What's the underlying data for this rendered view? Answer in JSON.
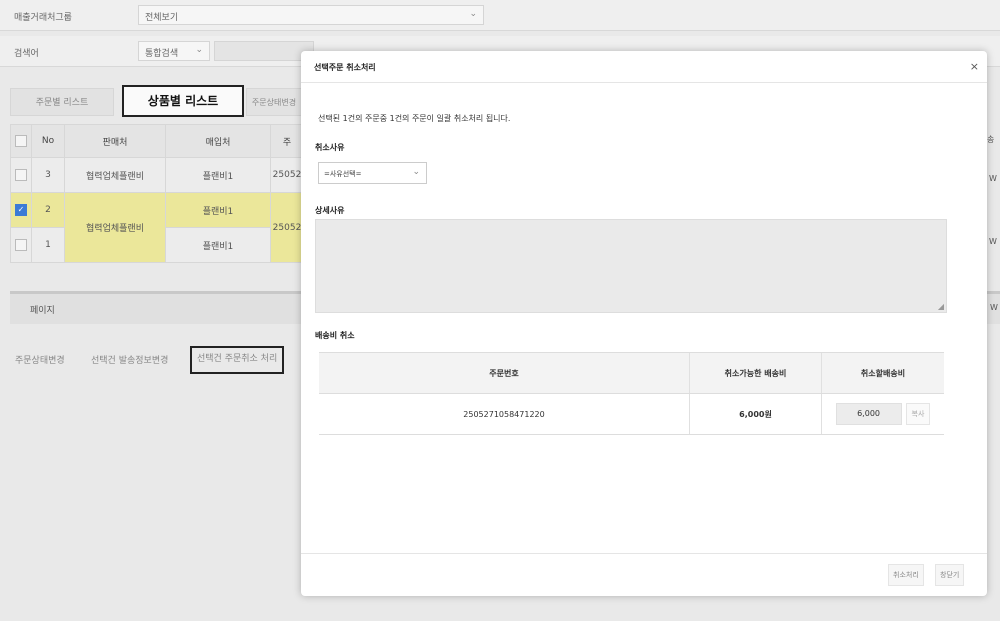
{
  "filters": {
    "partner_group": {
      "label": "매출거래처그룹",
      "value": "전체보기"
    },
    "search": {
      "label": "검색어",
      "type": "통합검색"
    }
  },
  "tabs": [
    "주문별 리스트",
    "상품별 리스트",
    "주문상태변경"
  ],
  "grid": {
    "headers": [
      "No",
      "판매처",
      "매입처",
      "주"
    ],
    "rows": [
      {
        "no": "3",
        "seller": "협력업체플랜비",
        "buyer": "플랜비1",
        "order": "25052",
        "extra": "W",
        "checked": false
      },
      {
        "no": "2",
        "seller": "협력업체플랜비",
        "buyer": "플랜비1",
        "order": "25052",
        "extra": "W",
        "checked": true
      },
      {
        "no": "1",
        "seller": "",
        "buyer": "플랜비1",
        "order": "",
        "extra": "",
        "checked": false
      }
    ],
    "right_header": "송",
    "pager_label": "페이지",
    "pager_extra": "W"
  },
  "bottom_buttons": [
    "주문상태변경",
    "선택건 발송정보변경",
    "선택건 주문취소 처리"
  ],
  "modal": {
    "title": "선택주문 취소처리",
    "close": "×",
    "intro": "선택된 1건의 주문중 1건의 주문이 일괄 취소처리 됩니다.",
    "reason_label": "취소사유",
    "reason_select": "=사유선택=",
    "detail_label": "상세사유",
    "shipping_label": "배송비 취소",
    "table": {
      "headers": [
        "주문번호",
        "취소가능한 배송비",
        "취소할배송비"
      ],
      "row": {
        "order_no": "2505271058471220",
        "available": "6,000원",
        "amount": "6,000",
        "copy": "복사"
      }
    },
    "buttons": {
      "process": "취소처리",
      "close": "창닫기"
    }
  }
}
